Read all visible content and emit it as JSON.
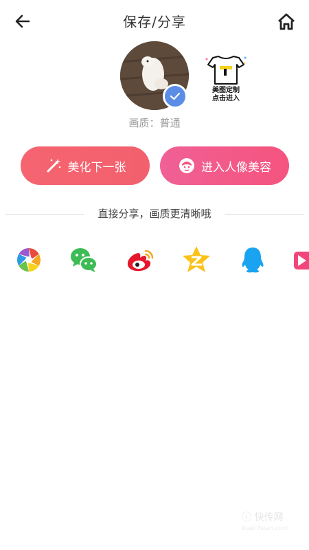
{
  "header": {
    "title": "保存/分享"
  },
  "photo": {
    "quality_text": "画质：普通"
  },
  "custom_tile": {
    "line1": "美图定制",
    "line2": "点击进入"
  },
  "buttons": {
    "beautify_next": "美化下一张",
    "enter_portrait": "进入人像美容"
  },
  "share": {
    "divider_text": "直接分享，画质更清晰哦",
    "targets": [
      {
        "icon": "aperture-icon"
      },
      {
        "icon": "wechat-icon"
      },
      {
        "icon": "weibo-icon"
      },
      {
        "icon": "qzone-icon"
      },
      {
        "icon": "qq-icon"
      },
      {
        "icon": "video-share-icon"
      }
    ]
  },
  "colors": {
    "beautify_button": "#f2606d",
    "portrait_button": "#f5547e",
    "check_badge": "#5b8de6"
  }
}
